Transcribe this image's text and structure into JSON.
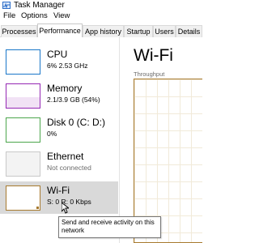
{
  "window": {
    "title": "Task Manager",
    "icon": "task-manager-icon"
  },
  "menu": [
    "File",
    "Options",
    "View"
  ],
  "tabs": [
    {
      "label": "Processes",
      "active": false
    },
    {
      "label": "Performance",
      "active": true
    },
    {
      "label": "App history",
      "active": false
    },
    {
      "label": "Startup",
      "active": false
    },
    {
      "label": "Users",
      "active": false
    },
    {
      "label": "Details",
      "active": false
    }
  ],
  "sidebar": {
    "items": [
      {
        "name": "CPU",
        "detail": "6% 2.53 GHz",
        "color": "#1a77c9",
        "selected": false
      },
      {
        "name": "Memory",
        "detail": "2.1/3.9 GB (54%)",
        "color": "#9528b4",
        "selected": false
      },
      {
        "name": "Disk 0 (C: D:)",
        "detail": "0%",
        "color": "#4ca64c",
        "selected": false
      },
      {
        "name": "Ethernet",
        "detail": "Not connected",
        "color": "#c8c8c8",
        "selected": false
      },
      {
        "name": "Wi-Fi",
        "detail": "S: 0 R: 0 Kbps",
        "color": "#a77a2f",
        "selected": true
      }
    ]
  },
  "main": {
    "title": "Wi-Fi",
    "graph_label": "Throughput",
    "graph_color": "#a77a2f"
  },
  "tooltip": {
    "text": "Send and receive activity on this network"
  }
}
